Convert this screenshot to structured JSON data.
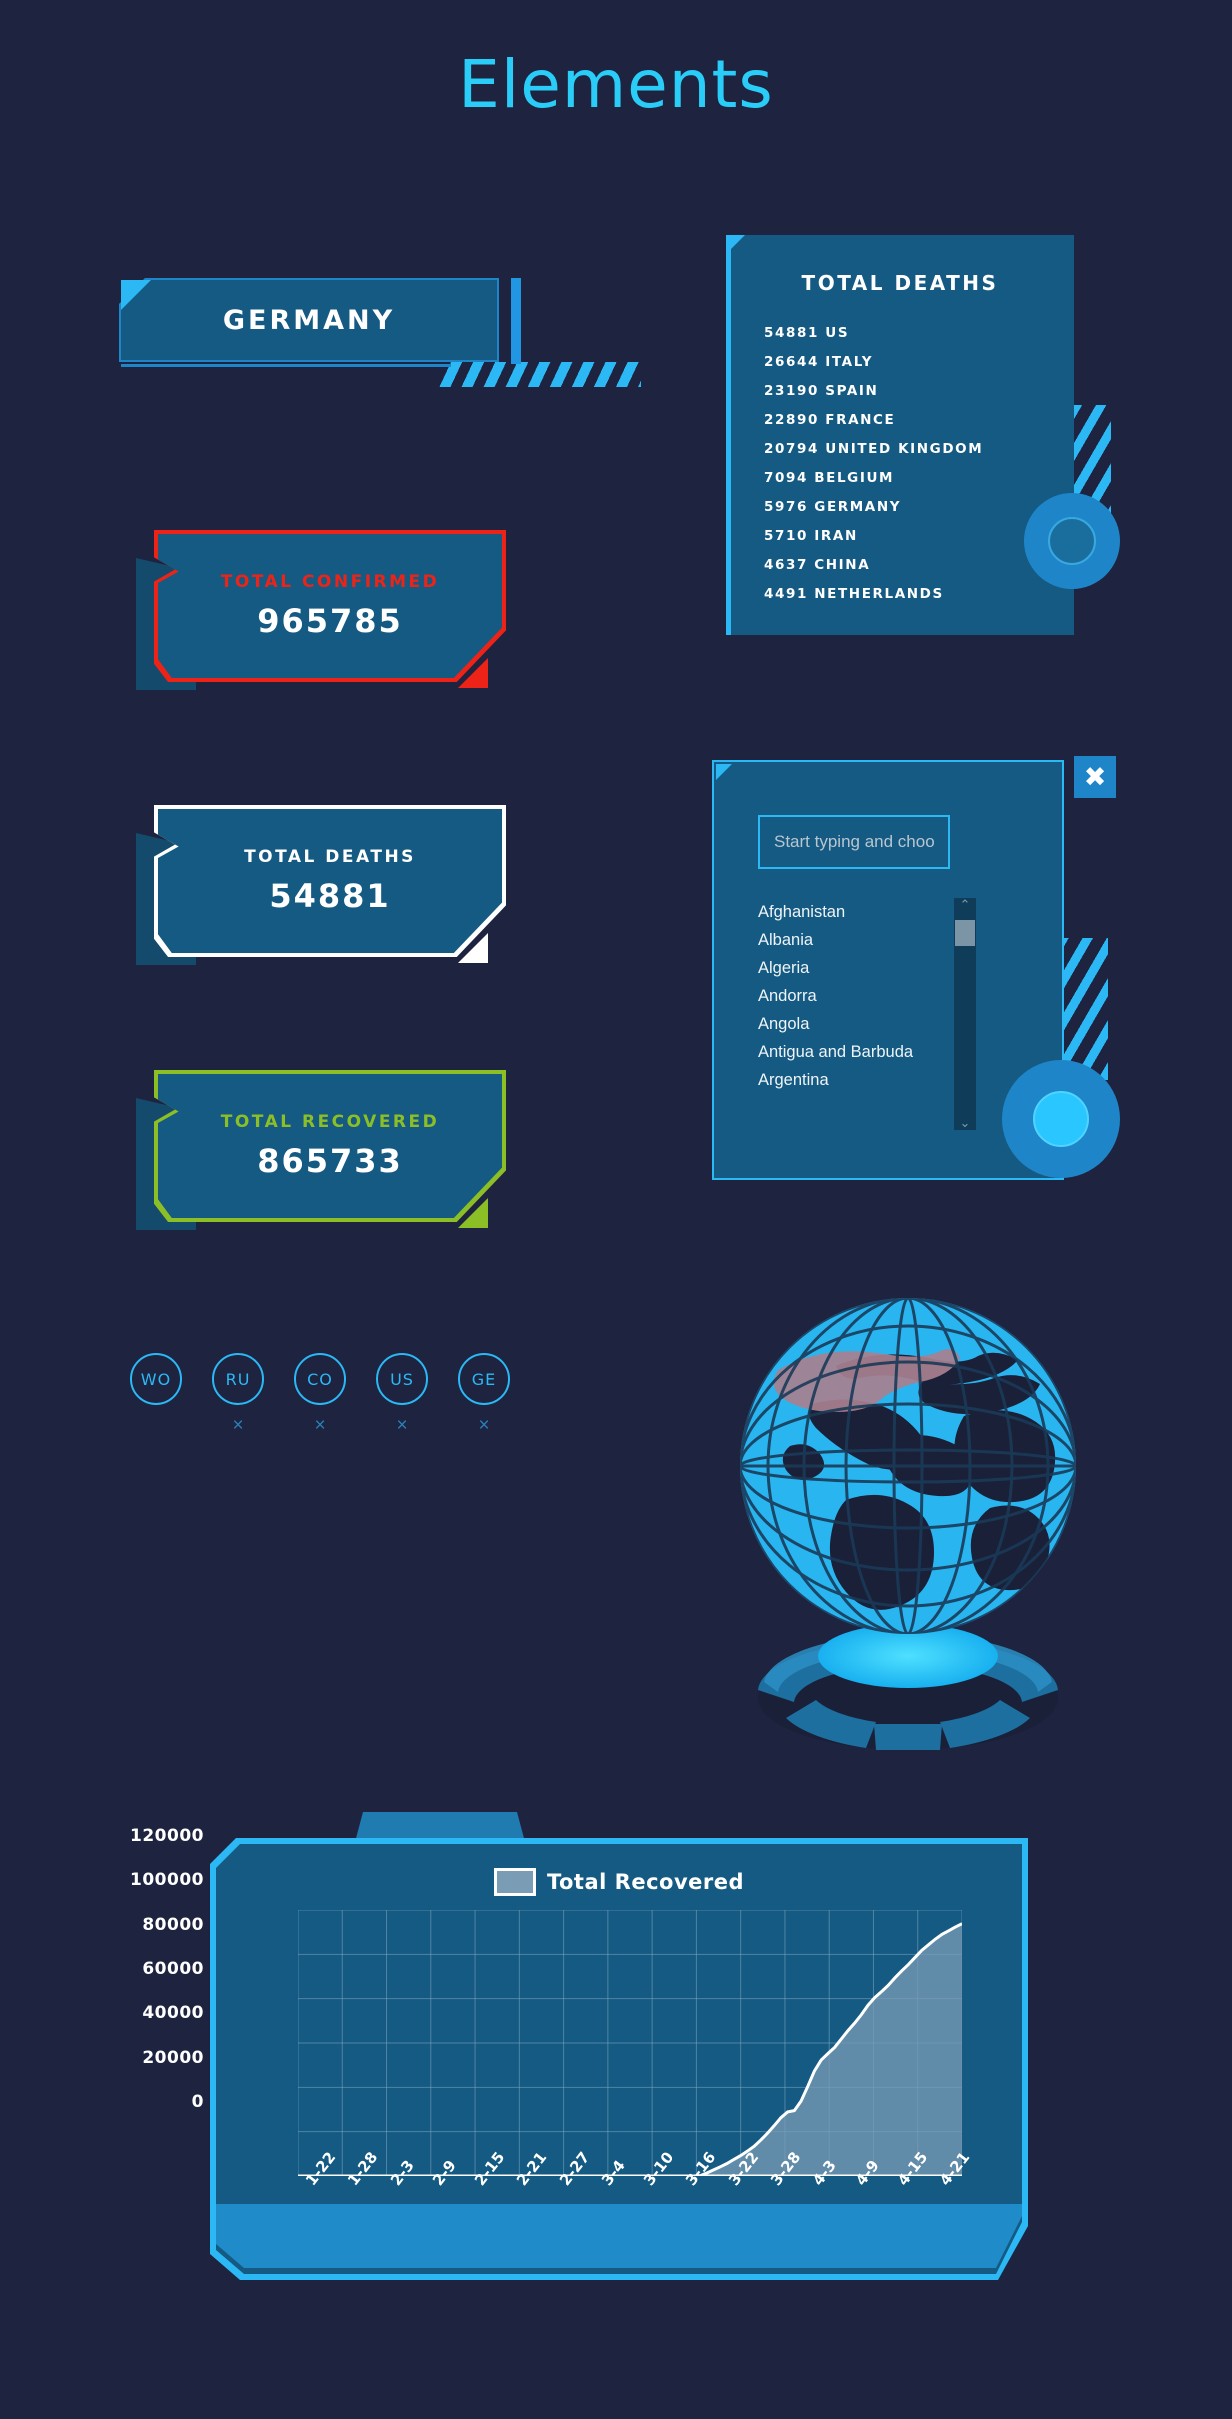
{
  "page": {
    "title": "Elements",
    "background_color": "#1e2340",
    "accent_color": "#2bb8f5",
    "panel_color": "#155a82"
  },
  "country_chip": {
    "label": "GERMANY"
  },
  "stat_cards": [
    {
      "name": "total-confirmed",
      "title": "TOTAL CONFIRMED",
      "value": "965785",
      "accent": "#ee2318"
    },
    {
      "name": "total-deaths",
      "title": "TOTAL DEATHS",
      "value": "54881",
      "accent": "#ffffff"
    },
    {
      "name": "total-recovered",
      "title": "TOTAL RECOVERED",
      "value": "865733",
      "accent": "#8cbf26"
    }
  ],
  "circle_toggles": [
    {
      "code": "WO",
      "has_remove": false,
      "remove_icon": "×"
    },
    {
      "code": "RU",
      "has_remove": true,
      "remove_icon": "×"
    },
    {
      "code": "CO",
      "has_remove": true,
      "remove_icon": "×"
    },
    {
      "code": "US",
      "has_remove": true,
      "remove_icon": "×"
    },
    {
      "code": "GE",
      "has_remove": true,
      "remove_icon": "×"
    }
  ],
  "deaths_panel": {
    "title": "TOTAL DEATHS",
    "rows": [
      "54881 US",
      "26644 ITALY",
      "23190 SPAIN",
      "22890 FRANCE",
      "20794 UNITED KINGDOM",
      "7094 BELGIUM",
      "5976 GERMANY",
      "5710 IRAN",
      "4637 CHINA",
      "4491 NETHERLANDS"
    ]
  },
  "dropdown_panel": {
    "close_icon": "✖",
    "search": {
      "value": "",
      "placeholder": "Start typing and choose country"
    },
    "scroll_up_icon": "⌃",
    "scroll_down_icon": "⌄",
    "options": [
      "Afghanistan",
      "Albania",
      "Algeria",
      "Andorra",
      "Angola",
      "Antigua and Barbuda",
      "Argentina"
    ]
  },
  "globe": {
    "highlighted_region": "United States",
    "highlight_color": "#a8808f",
    "ocean_color": "#29b6f0",
    "land_color": "#1a2038"
  },
  "chart_data": {
    "type": "area",
    "title": "",
    "legend": [
      "Total Recovered"
    ],
    "legend_position": "top-center",
    "series_color": "#7a9cb5",
    "line_color": "#ffffff",
    "grid": true,
    "xlabel": "",
    "ylabel": "",
    "ylim": [
      0,
      120000
    ],
    "yticks": [
      0,
      20000,
      40000,
      60000,
      80000,
      100000,
      120000
    ],
    "ytick_labels": [
      "0",
      "20000",
      "40000",
      "60000",
      "80000",
      "100000",
      "120000"
    ],
    "xtick_labels": [
      "1-22",
      "1-28",
      "2-3",
      "2-9",
      "2-15",
      "2-21",
      "2-27",
      "3-4",
      "3-10",
      "3-16",
      "3-22",
      "3-28",
      "4-3",
      "4-9",
      "4-15",
      "4-21"
    ],
    "series": [
      {
        "name": "Total Recovered",
        "values": [
          0,
          0,
          0,
          0,
          0,
          0,
          0,
          0,
          0,
          0,
          0,
          0,
          0,
          0,
          0,
          0,
          0,
          0,
          0,
          0,
          0,
          0,
          0,
          0,
          0,
          0,
          0,
          0,
          0,
          0,
          0,
          0,
          0,
          0,
          0,
          0,
          0,
          0,
          0,
          0,
          0,
          0,
          0,
          0,
          0,
          0,
          0,
          0,
          0,
          0,
          0,
          0,
          0,
          0,
          0,
          0,
          0,
          0,
          0,
          0,
          180,
          1400,
          2800,
          4200,
          5700,
          7500,
          9200,
          11200,
          13400,
          16200,
          19300,
          22700,
          26300,
          28900,
          29500,
          33800,
          40400,
          47400,
          52300,
          55200,
          58000,
          61800,
          65600,
          69000,
          72800,
          77100,
          80500,
          83200,
          86000,
          89400,
          92500,
          95400,
          98600,
          101800,
          104300,
          106800,
          109000,
          110600,
          112300,
          113800
        ]
      }
    ]
  }
}
